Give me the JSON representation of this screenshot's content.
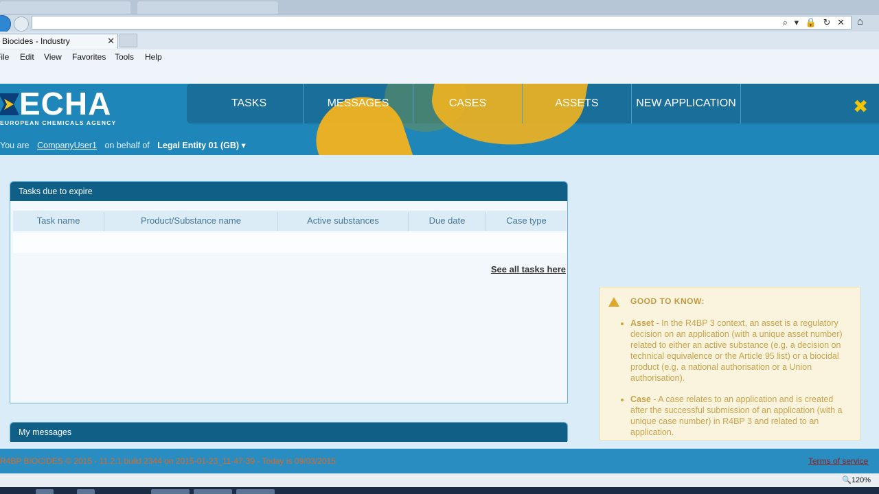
{
  "browser": {
    "tab_title": "Biocides - Industry",
    "tab_close": "✕",
    "menu": [
      "File",
      "Edit",
      "View",
      "Favorites",
      "Tools",
      "Help"
    ],
    "address_icons": "⌕ ▾ 🔒 ↻ ✕",
    "zoom_level": "120%"
  },
  "header": {
    "logo_text": "ECHA",
    "logo_subtitle": "EUROPEAN CHEMICALS AGENCY",
    "nav": [
      "TASKS",
      "MESSAGES",
      "CASES",
      "ASSETS",
      "NEW APPLICATION"
    ],
    "close_symbol": "✖",
    "user_prefix": "You are",
    "user_name": "CompanyUser1",
    "on_behalf": "on behalf of",
    "entity": "Legal Entity 01 (GB) ▾"
  },
  "tasks_panel": {
    "title": "Tasks due to expire",
    "columns": [
      "Task name",
      "Product/Substance name",
      "Active substances",
      "Due date",
      "Case type"
    ],
    "rows": [],
    "see_all": "See all tasks here"
  },
  "messages_panel": {
    "title": "My messages"
  },
  "info_box": {
    "title": "GOOD TO KNOW:",
    "items": [
      {
        "term": "Asset",
        "text": " - In the R4BP 3 context, an asset is a regulatory decision on an application (with a unique asset number) related to either an active substance (e.g. a decision on technical equivalence or the Article 95 list) or a biocidal product (e.g. a national authorisation or a Union authorisation)."
      },
      {
        "term": "Case",
        "text": " - A case relates to an application and is created after the successful submission of an application (with a unique case number) in R4BP 3 and related to an application."
      }
    ]
  },
  "footer": {
    "text": "R4BP BIOCIDES © 2015 - 11.2.1 build 2344 on 2015-01-23_11-47-39 - Today is 09/03/2015",
    "terms": "Terms of service"
  },
  "colors": {
    "header_blue": "#1f86b9",
    "panel_title": "#0f5f87",
    "accent_yellow": "#f2b21f",
    "close_yellow": "#f5c400"
  }
}
